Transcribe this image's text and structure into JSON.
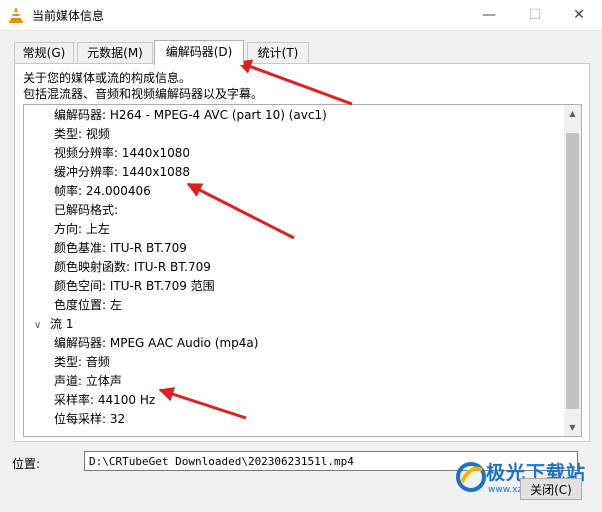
{
  "window": {
    "title": "当前媒体信息",
    "minimize": "—",
    "maximize": "☐",
    "close": "✕"
  },
  "tabs": [
    {
      "label": "常规(G)"
    },
    {
      "label": "元数据(M)"
    },
    {
      "label": "编解码器(D)"
    },
    {
      "label": "统计(T)"
    }
  ],
  "active_tab": 2,
  "description": {
    "line1": "关于您的媒体或流的构成信息。",
    "line2": "包括混流器、音频和视频编解码器以及字幕。"
  },
  "tree": {
    "stream0_children": [
      "编解码器: H264 - MPEG-4 AVC (part 10) (avc1)",
      "类型: 视频",
      "视频分辨率: 1440x1080",
      "缓冲分辨率: 1440x1088",
      "帧率: 24.000406",
      "已解码格式:",
      "方向: 上左",
      "颜色基准: ITU-R BT.709",
      "颜色映射函数: ITU-R BT.709",
      "颜色空间: ITU-R BT.709 范围",
      "色度位置: 左"
    ],
    "stream1_label": "流 1",
    "stream1_children": [
      "编解码器: MPEG AAC Audio (mp4a)",
      "类型: 音频",
      "声道: 立体声",
      "采样率: 44100 Hz",
      "位每采样: 32"
    ]
  },
  "location": {
    "label": "位置:",
    "value": "D:\\CRTubeGet Downloaded\\20230623151l.mp4"
  },
  "close_button": "关闭(C)",
  "watermark": {
    "text": "极光下载站",
    "sub": "www.xz7.com"
  },
  "colors": {
    "arrow": "#e02020",
    "accent": "#1a73c8"
  }
}
